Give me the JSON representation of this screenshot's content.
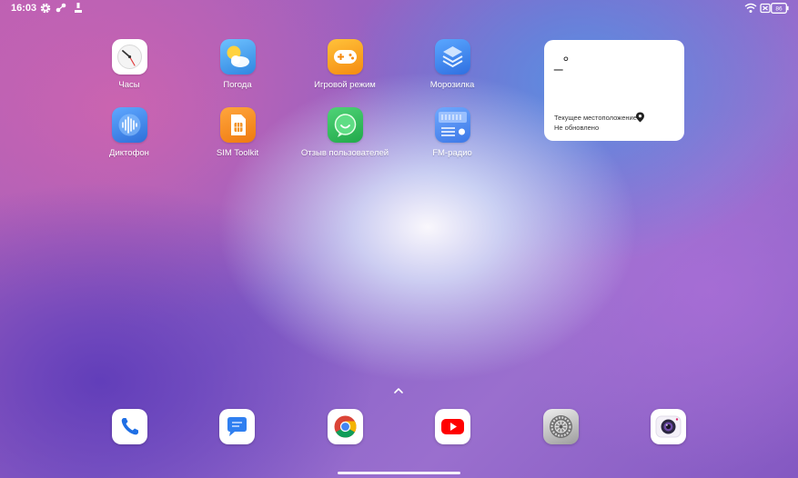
{
  "status_bar": {
    "time": "16:03",
    "left_icons": [
      "settings-gear-icon",
      "bluetooth-devices-icon",
      "usb-debug-icon"
    ],
    "right_icons": [
      "wifi-icon",
      "no-sim-icon",
      "battery-icon"
    ],
    "battery_level": "86"
  },
  "apps": [
    {
      "label": "Часы",
      "icon": "clock-icon"
    },
    {
      "label": "Погода",
      "icon": "weather-icon"
    },
    {
      "label": "Игровой режим",
      "icon": "gamepad-icon"
    },
    {
      "label": "Морозилка",
      "icon": "freezer-layers-icon"
    },
    {
      "label": "Диктофон",
      "icon": "voice-recorder-icon"
    },
    {
      "label": "SIM Toolkit",
      "icon": "sim-card-icon"
    },
    {
      "label": "Отзыв пользователей",
      "icon": "feedback-chat-icon"
    },
    {
      "label": "FM-радио",
      "icon": "radio-icon"
    }
  ],
  "weather_widget": {
    "temperature": "_°",
    "location": "Текущее местоположение",
    "status": "Не обновлено"
  },
  "dock": [
    "phone-icon",
    "messages-icon",
    "chrome-icon",
    "youtube-icon",
    "settings-icon",
    "camera-icon"
  ],
  "colors": {
    "weather": "#4aa3ee",
    "game": "#f7a21c",
    "freezer": "#3f7fe8",
    "recorder": "#3b7fe0",
    "sim": "#f38a1e",
    "feedback": "#2fbf5b",
    "radio": "#4d8ff0"
  }
}
